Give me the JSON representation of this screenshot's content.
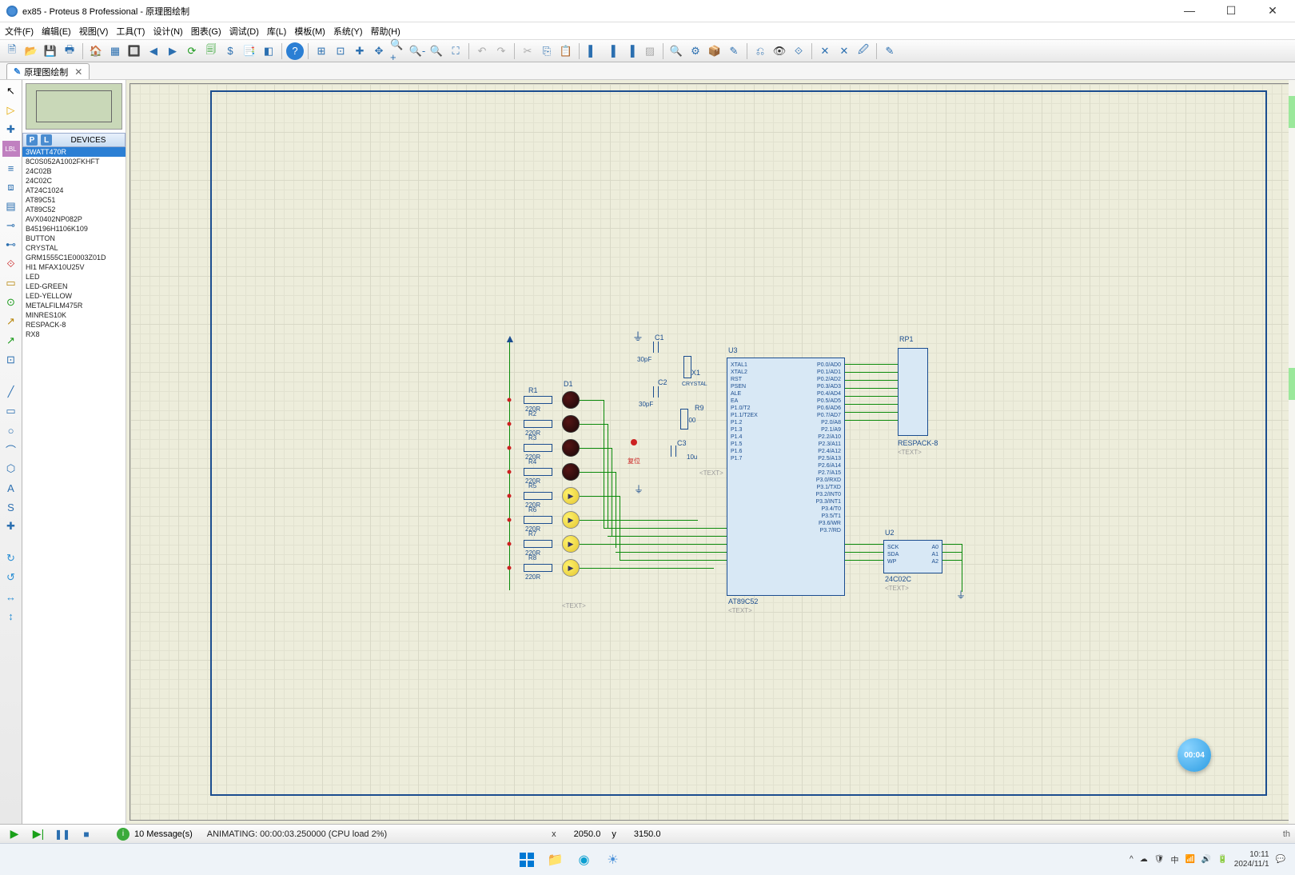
{
  "title": "ex85 - Proteus 8 Professional - 原理图绘制",
  "menu": [
    "文件(F)",
    "编辑(E)",
    "视图(V)",
    "工具(T)",
    "设计(N)",
    "图表(G)",
    "调试(D)",
    "库(L)",
    "模板(M)",
    "系统(Y)",
    "帮助(H)"
  ],
  "tab": {
    "label": "原理图绘制",
    "icon": "✎"
  },
  "devices_header": "DEVICES",
  "devices": [
    "3WATT470R",
    "8C0S052A1002FKHFT",
    "24C02B",
    "24C02C",
    "AT24C1024",
    "AT89C51",
    "AT89C52",
    "AVX0402NP082P",
    "B45196H1106K109",
    "BUTTON",
    "CRYSTAL",
    "GRM1555C1E0003Z01D",
    "HI1 MFAX10U25V",
    "LED",
    "LED-GREEN",
    "LED-YELLOW",
    "METALFILM475R",
    "MINRES10K",
    "RESPACK-8",
    "RX8"
  ],
  "schematic": {
    "u3": {
      "ref": "U3",
      "value": "AT89C52",
      "text": "<TEXT>",
      "pins_left": [
        "XTAL1",
        "",
        "XTAL2",
        "",
        "",
        "RST",
        "",
        "",
        "PSEN",
        "ALE",
        "EA",
        "",
        "",
        "P1.0/T2",
        "P1.1/T2EX",
        "P1.2",
        "P1.3",
        "P1.4",
        "P1.5",
        "P1.6",
        "P1.7"
      ],
      "pins_right": [
        "P0.0/AD0",
        "P0.1/AD1",
        "P0.2/AD2",
        "P0.3/AD3",
        "P0.4/AD4",
        "P0.5/AD5",
        "P0.6/AD6",
        "P0.7/AD7",
        "",
        "P2.0/A8",
        "P2.1/A9",
        "P2.2/A10",
        "P2.3/A11",
        "P2.4/A12",
        "P2.5/A13",
        "P2.6/A14",
        "P2.7/A15",
        "",
        "P3.0/RXD",
        "P3.1/TXD",
        "P3.2/INT0",
        "P3.3/INT1",
        "P3.4/T0",
        "P3.5/T1",
        "P3.6/WR",
        "P3.7/RD"
      ]
    },
    "u2": {
      "ref": "U2",
      "value": "24C02C",
      "text": "<TEXT>",
      "pins_left": [
        "SCK",
        "SDA",
        "WP"
      ],
      "pins_right": [
        "A0",
        "A1",
        "A2"
      ]
    },
    "rp1": {
      "ref": "RP1",
      "value": "RESPACK-8",
      "text": "<TEXT>"
    },
    "caps": {
      "c1": {
        "ref": "C1",
        "val": "30pF"
      },
      "c2": {
        "ref": "C2",
        "val": "30pF"
      },
      "c3": {
        "ref": "C3",
        "val": "10u"
      }
    },
    "r9": {
      "ref": "R9",
      "val": "100"
    },
    "x1": {
      "ref": "X1",
      "val": "CRYSTAL"
    },
    "button_label": "复位",
    "d1": "D1",
    "resistors": [
      {
        "ref": "R1",
        "val": "220R"
      },
      {
        "ref": "R2",
        "val": "220R"
      },
      {
        "ref": "R3",
        "val": "220R"
      },
      {
        "ref": "R4",
        "val": "220R"
      },
      {
        "ref": "R5",
        "val": "220R"
      },
      {
        "ref": "R6",
        "val": "220R"
      },
      {
        "ref": "R7",
        "val": "220R"
      },
      {
        "ref": "R8",
        "val": "220R"
      }
    ],
    "generic_text": "<TEXT>"
  },
  "timer": "00:04",
  "status": {
    "messages_count": "i",
    "messages_label": "10 Message(s)",
    "anim": "ANIMATING: 00:00:03.250000 (CPU load 2%)",
    "coord_x_label": "x",
    "coord_x": "2050.0",
    "coord_y_label": "y",
    "coord_y": "3150.0",
    "th": "th"
  },
  "tray": {
    "time": "10:11",
    "date": "2024/11/1",
    "ime": "中"
  }
}
